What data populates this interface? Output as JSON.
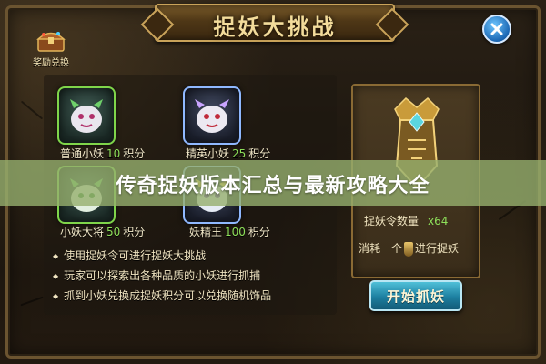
{
  "title": "捉妖大挑战",
  "reward_label": "奖励兑换",
  "monsters": [
    {
      "name": "普通小妖",
      "points": "10",
      "unit": "积分",
      "frame_color": "#7fd54a"
    },
    {
      "name": "精英小妖",
      "points": "25",
      "unit": "积分",
      "frame_color": "#8fb8ff"
    },
    {
      "name": "小妖大将",
      "points": "50",
      "unit": "积分",
      "frame_color": "#7fd54a"
    },
    {
      "name": "妖精王",
      "points": "100",
      "unit": "积分",
      "frame_color": "#8fb8ff"
    }
  ],
  "rules": [
    "使用捉妖令可进行捉妖大挑战",
    "玩家可以探索出各种品质的小妖进行抓捕",
    "抓到小妖兑换成捉妖积分可以兑换随机饰品"
  ],
  "side": {
    "count_label": "捉妖令数量",
    "count_value": "x64",
    "consume_pre": "消耗一个",
    "consume_post": "进行捉妖"
  },
  "start_button": "开始抓妖",
  "banner": "传奇捉妖版本汇总与最新攻略大全",
  "colors": {
    "accent_green": "#8ee05a",
    "gold": "#c9a35a",
    "button_blue": "#1d7fa0"
  }
}
